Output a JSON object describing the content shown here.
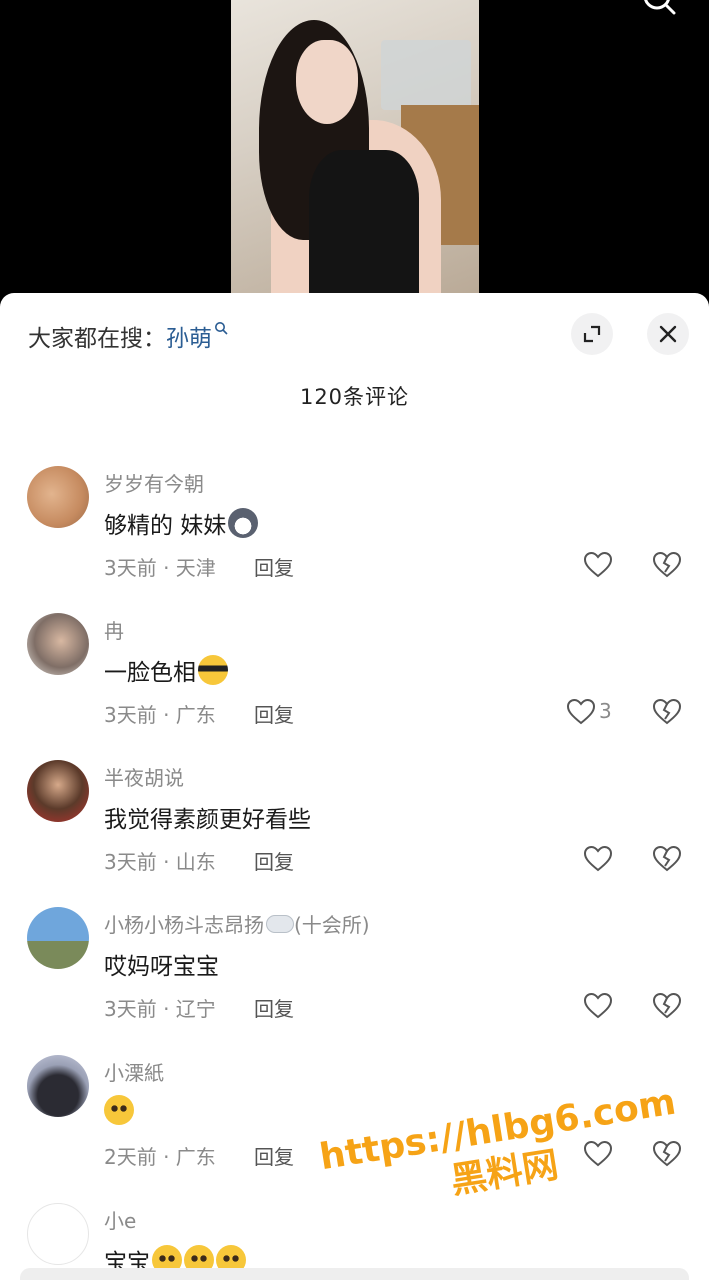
{
  "hot_search": {
    "prefix": "大家都在搜：",
    "keyword": "孙萌"
  },
  "comment_count_label": "120条评论",
  "icons": {
    "search": "search-icon",
    "expand": "expand-icon",
    "close": "close-icon",
    "like": "heart-outline-icon",
    "dislike": "broken-heart-icon"
  },
  "colors": {
    "keyword": "#2b5d93",
    "watermark": "#f6a316"
  },
  "comments": [
    {
      "user": "岁岁有今朝",
      "text": "够精的  妹妹",
      "emoji": "husky-emoji",
      "time_location": "3天前 · 天津",
      "reply": "回复",
      "likes": ""
    },
    {
      "user": "冉",
      "text": "一脸色相",
      "emoji": "sunglasses-emoji",
      "time_location": "3天前 · 广东",
      "reply": "回复",
      "likes": "3"
    },
    {
      "user": "半夜胡说",
      "text": "我觉得素颜更好看些",
      "emoji": "",
      "time_location": "3天前 · 山东",
      "reply": "回复",
      "likes": ""
    },
    {
      "user": "小杨小杨斗志昂扬",
      "user_suffix": "(十会所)",
      "user_emoji": "cloud-emoji",
      "text": "哎妈呀宝宝",
      "emoji": "",
      "time_location": "3天前 · 辽宁",
      "reply": "回复",
      "likes": ""
    },
    {
      "user": "小溧紙",
      "text": "",
      "emoji": "pleading-face-emoji",
      "time_location": "2天前 · 广东",
      "reply": "回复",
      "likes": ""
    },
    {
      "user": "小e",
      "text": "宝宝",
      "emoji": "pleading-face-emoji x3",
      "time_location": "",
      "reply": "",
      "likes": ""
    }
  ],
  "watermark": {
    "url": "https://hlbg6.com",
    "site": "黑料网"
  }
}
